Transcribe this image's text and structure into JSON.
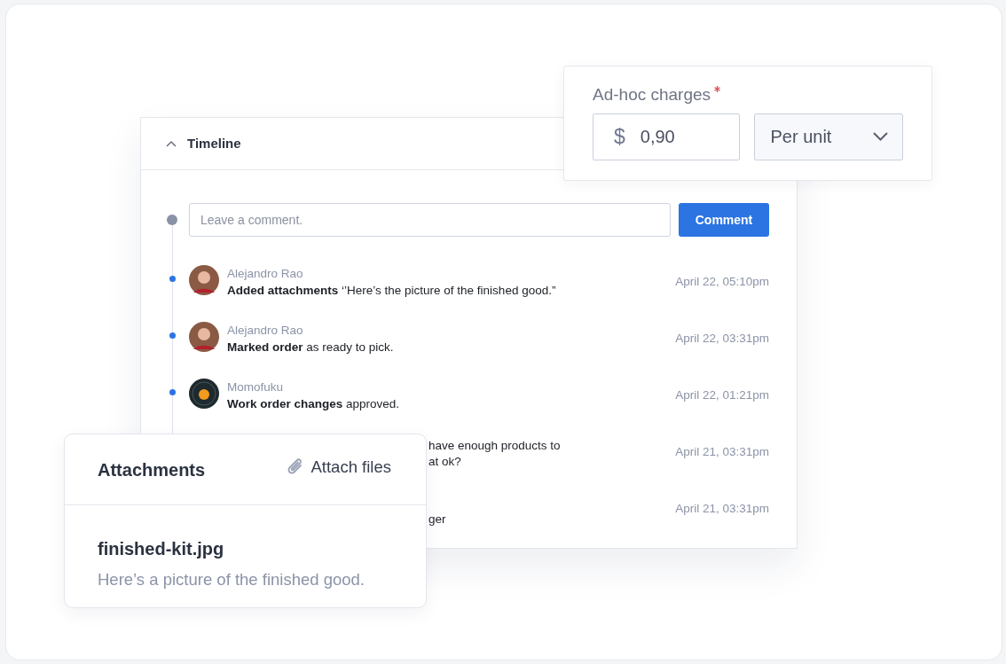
{
  "timeline": {
    "title": "Timeline",
    "expanded": true,
    "comment_field": {
      "placeholder": "Leave a comment."
    },
    "comment_button": "Comment",
    "events": [
      {
        "kind": "person",
        "author": "Alejandro Rao",
        "message": "**Added attachments** ‘’Here’s the picture of the finished good.”",
        "time": "April 22, 05:10pm"
      },
      {
        "kind": "person",
        "author": "Alejandro Rao",
        "message": "**Marked order** as ready to pick.",
        "time": "April 22, 03:31pm"
      },
      {
        "kind": "brand",
        "author": "Momofuku",
        "message": "**Work order changes** approved.",
        "time": "April 22, 01:21pm"
      },
      {
        "kind": "hidden",
        "lines": [
          "have enough products to",
          "at ok?"
        ],
        "time": "April 21, 03:31pm"
      },
      {
        "kind": "hidden",
        "lines": [
          "ger"
        ],
        "time": "April 21, 03:31pm"
      }
    ]
  },
  "charges": {
    "label": "Ad-hoc charges",
    "required": true,
    "currency": "$",
    "value": "0,90",
    "unit": "Per unit"
  },
  "attachments": {
    "title": "Attachments",
    "attach_button": "Attach files",
    "file": {
      "name": "finished-kit.jpg",
      "description": "Here’s a picture of the finished good."
    }
  }
}
